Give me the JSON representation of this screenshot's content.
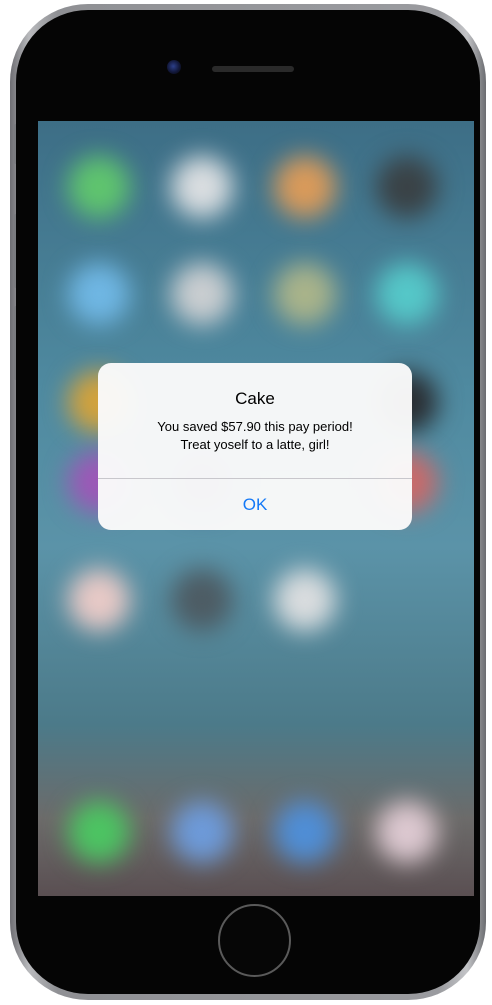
{
  "alert": {
    "title": "Cake",
    "message_line1": "You saved $57.90 this pay period!",
    "message_line2": "Treat yoself to a latte, girl!",
    "ok_label": "OK"
  },
  "colors": {
    "alert_button": "#1479f7",
    "alert_background": "#fafafa",
    "phone_body": "#050505"
  },
  "icons": [
    "camera-icon",
    "speaker-grille-icon",
    "home-button-icon"
  ]
}
